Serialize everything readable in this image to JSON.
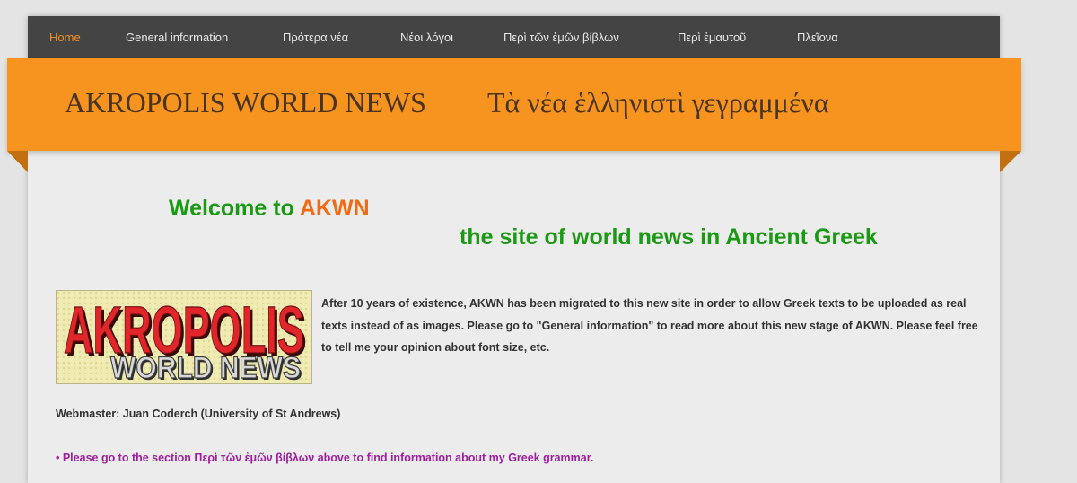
{
  "nav": {
    "items": [
      {
        "label": "Home",
        "active": true
      },
      {
        "label": "General information"
      },
      {
        "label": "Πρότερα νέα"
      },
      {
        "label": "Νέοι λόγοι"
      },
      {
        "label": "Περὶ τῶν ἐμῶν βίβλων"
      },
      {
        "label": "Περὶ ἐμαυτοῦ"
      },
      {
        "label": "Πλεῖονα"
      }
    ]
  },
  "banner": {
    "title": "AKROPOLIS WORLD NEWS",
    "subtitle": "Τὰ νέα ἑλληνιστὶ γεγραμμένα"
  },
  "main": {
    "welcome_prefix": "Welcome to ",
    "welcome_accent": "AKWN",
    "tagline": "the site of world news in Ancient Greek",
    "logo_line1": "AKROPOLIS",
    "logo_line2": "WORLD NEWS",
    "intro": "After 10 years of existence, AKWN has been migrated to this new site in order to allow Greek texts to be uploaded as real texts instead of as images. Please go to \"General information\" to read more about this new stage of AKWN. Please feel free to tell me your opinion about font size, etc.",
    "webmaster": "Webmaster: Juan Coderch (University of St Andrews)",
    "grammar_note": "• Please go to the section Περὶ τῶν ἐμῶν βίβλων above to find information about my Greek grammar."
  },
  "colors": {
    "nav_bg": "#444444",
    "nav_active": "#f0901f",
    "banner_bg": "#f6941f",
    "green": "#199a12",
    "orange_accent": "#f26b12",
    "purple_link": "#a01ea0"
  }
}
